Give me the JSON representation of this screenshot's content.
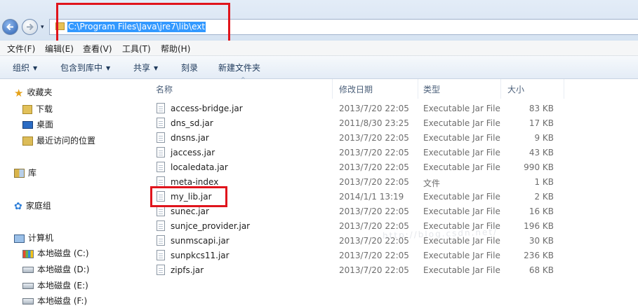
{
  "address": {
    "path": "C:\\Program Files\\Java\\jre7\\lib\\ext",
    "history_arrow": "▾"
  },
  "menu": [
    "文件(F)",
    "编辑(E)",
    "查看(V)",
    "工具(T)",
    "帮助(H)"
  ],
  "toolbar": {
    "organize": "组织",
    "include_library": "包含到库中",
    "share": "共享",
    "burn": "刻录",
    "new_folder": "新建文件夹",
    "dropdown_arrow": "▼"
  },
  "nav": {
    "favorites": "收藏夹",
    "downloads": "下载",
    "desktop": "桌面",
    "recent": "最近访问的位置",
    "libraries": "库",
    "homegroup": "家庭组",
    "computer": "计算机",
    "drive_c": "本地磁盘 (C:)",
    "drive_d": "本地磁盘 (D:)",
    "drive_e": "本地磁盘 (E:)",
    "drive_f": "本地磁盘 (F:)"
  },
  "columns": {
    "name": "名称",
    "modified": "修改日期",
    "type": "类型",
    "size": "大小",
    "sort_indicator": "^"
  },
  "files": [
    {
      "name": "access-bridge.jar",
      "modified": "2013/7/20 22:05",
      "type": "Executable Jar File",
      "size": "83 KB"
    },
    {
      "name": "dns_sd.jar",
      "modified": "2011/8/30 23:25",
      "type": "Executable Jar File",
      "size": "17 KB"
    },
    {
      "name": "dnsns.jar",
      "modified": "2013/7/20 22:05",
      "type": "Executable Jar File",
      "size": "9 KB"
    },
    {
      "name": "jaccess.jar",
      "modified": "2013/7/20 22:05",
      "type": "Executable Jar File",
      "size": "43 KB"
    },
    {
      "name": "localedata.jar",
      "modified": "2013/7/20 22:05",
      "type": "Executable Jar File",
      "size": "990 KB"
    },
    {
      "name": "meta-index",
      "modified": "2013/7/20 22:05",
      "type": "文件",
      "size": "1 KB"
    },
    {
      "name": "my_lib.jar",
      "modified": "2014/1/1 13:19",
      "type": "Executable Jar File",
      "size": "2 KB"
    },
    {
      "name": "sunec.jar",
      "modified": "2013/7/20 22:05",
      "type": "Executable Jar File",
      "size": "16 KB"
    },
    {
      "name": "sunjce_provider.jar",
      "modified": "2013/7/20 22:05",
      "type": "Executable Jar File",
      "size": "196 KB"
    },
    {
      "name": "sunmscapi.jar",
      "modified": "2013/7/20 22:05",
      "type": "Executable Jar File",
      "size": "30 KB"
    },
    {
      "name": "sunpkcs11.jar",
      "modified": "2013/7/20 22:05",
      "type": "Executable Jar File",
      "size": "236 KB"
    },
    {
      "name": "zipfs.jar",
      "modified": "2013/7/20 22:05",
      "type": "Executable Jar File",
      "size": "68 KB"
    }
  ],
  "watermark": "http://blog.csdn.net/",
  "colors": {
    "highlight_box": "#e0141c",
    "address_selection": "#3399ff"
  }
}
